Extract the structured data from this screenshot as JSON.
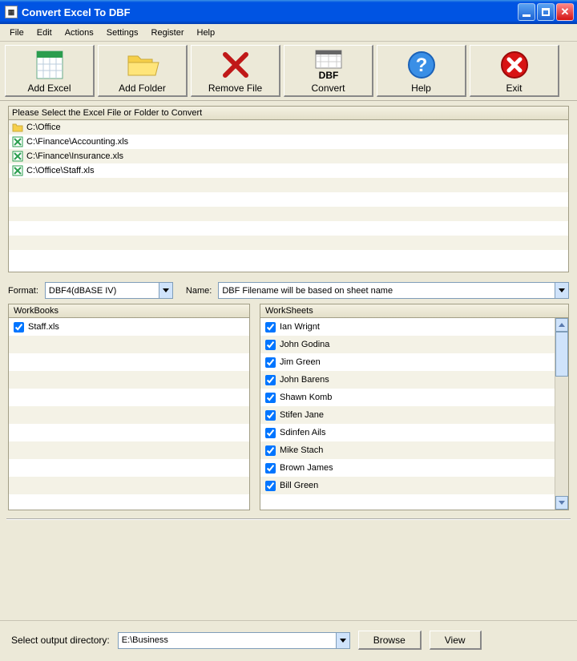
{
  "title": "Convert Excel To DBF",
  "menu": [
    "File",
    "Edit",
    "Actions",
    "Settings",
    "Register",
    "Help"
  ],
  "toolbar": [
    {
      "key": "add-excel",
      "label": "Add Excel"
    },
    {
      "key": "add-folder",
      "label": "Add Folder"
    },
    {
      "key": "remove-file",
      "label": "Remove File"
    },
    {
      "key": "convert",
      "label": "Convert"
    },
    {
      "key": "help",
      "label": "Help"
    },
    {
      "key": "exit",
      "label": "Exit"
    }
  ],
  "file_panel": {
    "title": "Please Select the Excel File or Folder to Convert",
    "items": [
      {
        "type": "folder",
        "path": "C:\\Office"
      },
      {
        "type": "xls",
        "path": "C:\\Finance\\Accounting.xls"
      },
      {
        "type": "xls",
        "path": "C:\\Finance\\Insurance.xls"
      },
      {
        "type": "xls",
        "path": "C:\\Office\\Staff.xls"
      }
    ]
  },
  "format": {
    "label": "Format:",
    "value": "DBF4(dBASE IV)"
  },
  "name": {
    "label": "Name:",
    "value": "DBF Filename will be based on sheet name"
  },
  "workbooks": {
    "label": "WorkBooks",
    "items": [
      {
        "name": "Staff.xls",
        "checked": true
      }
    ]
  },
  "worksheets": {
    "label": "WorkSheets",
    "items": [
      {
        "name": "Ian Wrignt",
        "checked": true
      },
      {
        "name": "John Godina",
        "checked": true
      },
      {
        "name": "Jim Green",
        "checked": true
      },
      {
        "name": "John Barens",
        "checked": true
      },
      {
        "name": "Shawn Komb",
        "checked": true
      },
      {
        "name": "Stifen Jane",
        "checked": true
      },
      {
        "name": "Sdinfen Ails",
        "checked": true
      },
      {
        "name": "Mike Stach",
        "checked": true
      },
      {
        "name": "Brown James",
        "checked": true
      },
      {
        "name": "Bill Green",
        "checked": true
      }
    ]
  },
  "output": {
    "label": "Select  output directory:",
    "value": "E:\\Business",
    "browse": "Browse",
    "view": "View"
  }
}
